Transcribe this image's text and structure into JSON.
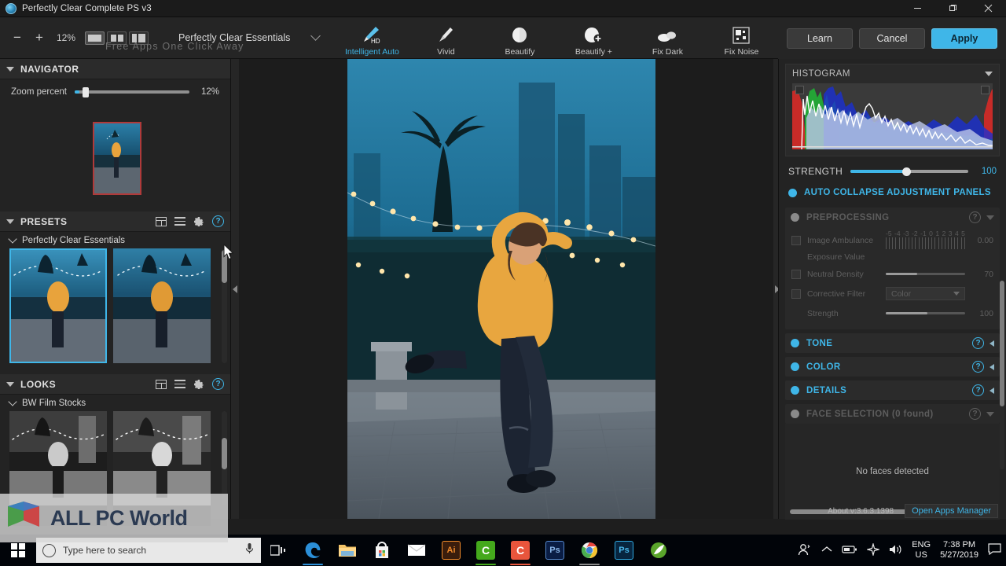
{
  "window": {
    "title": "Perfectly Clear Complete PS v3",
    "icon": "app-globe-icon",
    "controls": {
      "minimize": "minimize-icon",
      "restore": "restore-icon",
      "close": "close-icon"
    }
  },
  "toolbar": {
    "zoom_out": "−",
    "zoom_in": "+",
    "zoom_value": "12%",
    "view_modes": [
      {
        "name": "single-view",
        "active": true
      },
      {
        "name": "dual-view",
        "active": false
      },
      {
        "name": "split-view",
        "active": false
      }
    ],
    "preset_dropdown": "Perfectly Clear Essentials",
    "tools": [
      {
        "label": "Intelligent Auto",
        "icon": "brush-hd-icon",
        "active": true
      },
      {
        "label": "Vivid",
        "icon": "brush-icon",
        "active": false
      },
      {
        "label": "Beautify",
        "icon": "face-icon",
        "active": false
      },
      {
        "label": "Beautify +",
        "icon": "face-plus-icon",
        "active": false
      },
      {
        "label": "Fix Dark",
        "icon": "cloud-icon",
        "active": false
      },
      {
        "label": "Fix Noise",
        "icon": "noise-grid-icon",
        "active": false
      }
    ],
    "scroll_more": "▶"
  },
  "actions": {
    "learn": "Learn",
    "cancel": "Cancel",
    "apply": "Apply"
  },
  "left": {
    "navigator": {
      "title": "NAVIGATOR",
      "zoom_label": "Zoom percent",
      "zoom_percent": "12%"
    },
    "presets": {
      "title": "PRESETS",
      "icons": [
        "grid-view-icon",
        "list-view-icon",
        "gear-icon",
        "help-icon"
      ],
      "group": "Perfectly Clear Essentials"
    },
    "looks": {
      "title": "LOOKS",
      "icons": [
        "grid-view-icon",
        "list-view-icon",
        "gear-icon",
        "help-icon"
      ],
      "group": "BW Film Stocks"
    }
  },
  "right": {
    "histogram": {
      "title": "HISTOGRAM",
      "collapse": "collapse-icon"
    },
    "strength": {
      "label": "STRENGTH",
      "value": "100"
    },
    "auto_collapse": "AUTO COLLAPSE ADJUSTMENT PANELS",
    "sections": [
      {
        "name": "PREPROCESSING",
        "enabled": false,
        "controls": {
          "image_ambulance": "Image Ambulance",
          "exposure_label": "Exposure Value",
          "exposure_value": "0.00",
          "ruler_ticks": [
            "-5",
            "-4",
            "-3",
            "-2",
            "-1",
            "0",
            "1",
            "2",
            "3",
            "4",
            "5"
          ],
          "neutral_density": "Neutral Density",
          "neutral_density_value": "70",
          "corrective_filter": "Corrective Filter",
          "corrective_filter_option": "Color",
          "strength_label": "Strength",
          "strength_value": "100"
        }
      },
      {
        "name": "TONE",
        "enabled": true
      },
      {
        "name": "COLOR",
        "enabled": true
      },
      {
        "name": "DETAILS",
        "enabled": true
      },
      {
        "name": "FACE SELECTION (0 found)",
        "enabled": false
      }
    ],
    "faces_message": "No faces detected",
    "about_version": "About v:3.6.3.1398",
    "apps_manager": "Open Apps Manager"
  },
  "watermark": {
    "brand": "ALL PC World",
    "tagline": "Free Apps One Click Away"
  },
  "taskbar": {
    "start": "windows-start-icon",
    "search_placeholder": "Type here to search",
    "apps": [
      {
        "name": "task-view-icon",
        "label": ""
      },
      {
        "name": "edge-icon",
        "label": "e"
      },
      {
        "name": "file-explorer-icon",
        "label": ""
      },
      {
        "name": "microsoft-store-icon",
        "label": ""
      },
      {
        "name": "mail-icon",
        "label": ""
      },
      {
        "name": "illustrator-icon",
        "label": "Ai"
      },
      {
        "name": "green-c-app-icon",
        "label": "C"
      },
      {
        "name": "orange-c-app-icon",
        "label": "C"
      },
      {
        "name": "photoshop-icon",
        "label": "Ps"
      },
      {
        "name": "chrome-icon",
        "label": ""
      },
      {
        "name": "photoshop-alt-icon",
        "label": "Ps"
      },
      {
        "name": "green-leaf-app-icon",
        "label": ""
      }
    ],
    "tray": {
      "people": "people-icon",
      "chevron": "chevron-up-icon",
      "battery": "battery-icon",
      "airplane": "airplane-mode-icon",
      "volume": "volume-icon",
      "language_line1": "ENG",
      "language_line2": "US",
      "time": "7:38 PM",
      "date": "5/27/2019",
      "notifications": "notification-icon"
    }
  },
  "colors": {
    "accent": "#3fb6e8",
    "panel_bg": "#232323",
    "toolbar_bg": "#252525"
  }
}
